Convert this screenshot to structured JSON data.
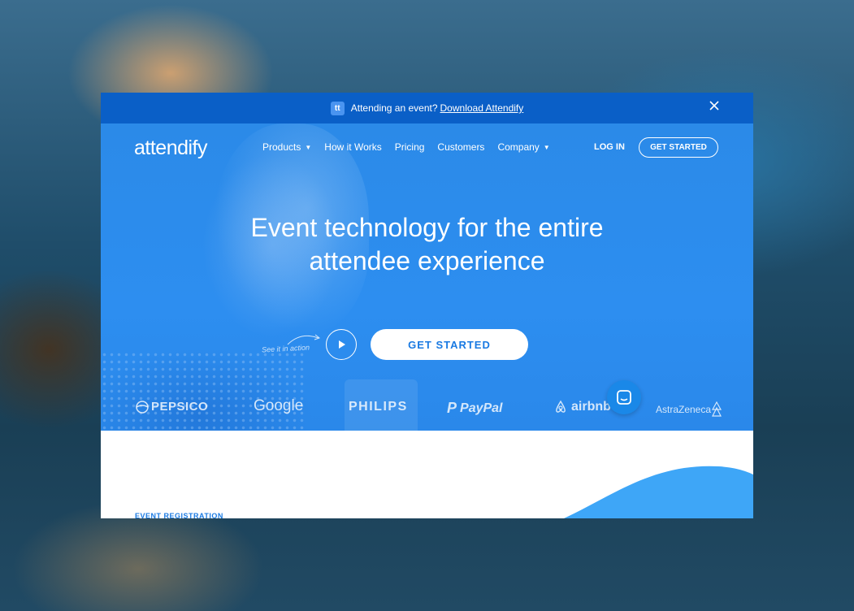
{
  "banner": {
    "badge_text": "tt",
    "text": "Attending an event?",
    "link": "Download Attendify",
    "close_icon": "close-icon"
  },
  "nav": {
    "logo": "attendify",
    "menu": [
      {
        "label": "Products",
        "dropdown": true
      },
      {
        "label": "How it Works",
        "dropdown": false
      },
      {
        "label": "Pricing",
        "dropdown": false
      },
      {
        "label": "Customers",
        "dropdown": false
      },
      {
        "label": "Company",
        "dropdown": true
      }
    ],
    "login": "LOG IN",
    "cta": "GET STARTED"
  },
  "hero": {
    "headline_line1": "Event technology for the entire",
    "headline_line2": "attendee experience",
    "see_in_action": "See it in action",
    "cta": "GET STARTED",
    "play_icon": "play-icon"
  },
  "brands": [
    "PEPSICO",
    "Google",
    "PHILIPS",
    "PayPal",
    "airbnb",
    "AstraZeneca"
  ],
  "section": {
    "label": "EVENT REGISTRATION"
  },
  "colors": {
    "banner": "#0a5fc7",
    "hero": "#2d8ef0",
    "accent": "#1a7ae2",
    "chat": "#1a88e8"
  }
}
